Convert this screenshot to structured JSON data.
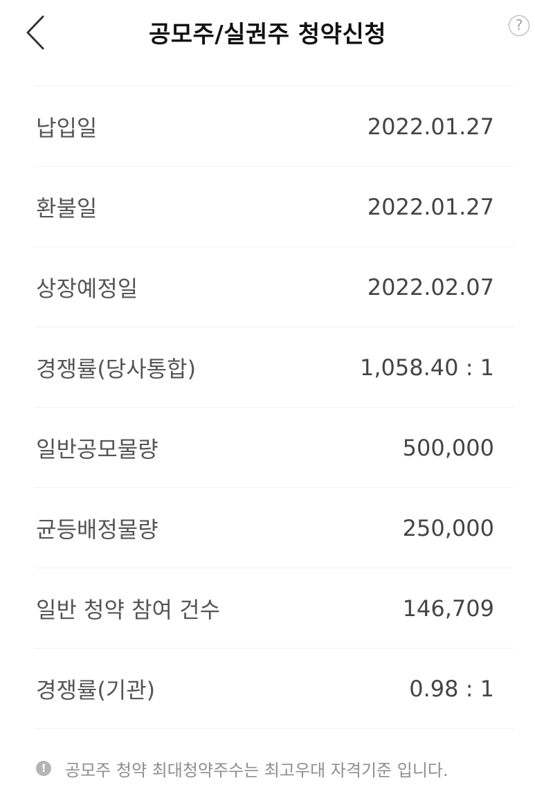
{
  "header": {
    "title": "공모주/실권주 청약신청",
    "back_icon": "chevron-left-icon",
    "help_icon": "question-circle-icon",
    "help_glyph": "?"
  },
  "details": [
    {
      "label": "납입일",
      "value": "2022.01.27"
    },
    {
      "label": "환불일",
      "value": "2022.01.27"
    },
    {
      "label": "상장예정일",
      "value": "2022.02.07"
    },
    {
      "label": "경쟁률(당사통합)",
      "value": "1,058.40 : 1"
    },
    {
      "label": "일반공모물량",
      "value": "500,000"
    },
    {
      "label": "균등배정물량",
      "value": "250,000"
    },
    {
      "label": "일반 청약 참여 건수",
      "value": "146,709"
    },
    {
      "label": "경쟁률(기관)",
      "value": "0.98 : 1"
    }
  ],
  "notice": {
    "icon": "exclamation-circle-icon",
    "glyph": "!",
    "text": "공모주 청약 최대청약주수는 최고우대 자격기준 입니다."
  }
}
